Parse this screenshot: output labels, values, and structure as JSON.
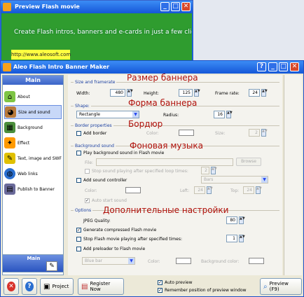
{
  "preview_window": {
    "title": "Preview Flash movie",
    "flash_text": "Create Flash intros, banners and e-cards in just a few clicks",
    "flash_link": "http://www.aleosoft.com",
    "controls": {
      "minimize": "_",
      "maximize": "□",
      "close": "✕"
    }
  },
  "main_window": {
    "title": "Aleo Flash Intro Banner Maker",
    "controls": {
      "help": "?",
      "minimize": "_",
      "maximize": "□",
      "close": "✕"
    }
  },
  "sidebar": {
    "header": "Main",
    "footer": "Main",
    "items": [
      {
        "label": "About",
        "icon": "house-icon",
        "color": "#7ec544"
      },
      {
        "label": "Size and sound",
        "icon": "palette-icon",
        "color": "#b97a3a"
      },
      {
        "label": "Background",
        "icon": "background-icon",
        "color": "#4c8f3c"
      },
      {
        "label": "Effect",
        "icon": "effect-icon",
        "color": "#ff9a00"
      },
      {
        "label": "Text, image and SWF",
        "icon": "pencil-icon",
        "color": "#e0c000"
      },
      {
        "label": "Web links",
        "icon": "globe-icon",
        "color": "#2a6fd0"
      },
      {
        "label": "Publish to Banner",
        "icon": "publish-icon",
        "color": "#6a6a9a"
      }
    ]
  },
  "size": {
    "section": "Size and framerate",
    "width_label": "Width:",
    "width": "480",
    "height_label": "Height:",
    "height": "125",
    "framerate_label": "Frame rate:",
    "framerate": "24"
  },
  "shape": {
    "section": "Shape:",
    "value": "Rectangle",
    "radius_label": "Radius:",
    "radius": "16"
  },
  "border": {
    "section": "Border properties",
    "add_label": "Add border",
    "color_label": "Color:",
    "size_label": "Size:",
    "size": "2"
  },
  "sound": {
    "section": "Background sound",
    "play_label": "Play background sound in Flash movie",
    "file_label": "File:",
    "browse": "Browse",
    "stop_label": "Stop sound playing after specified loop times:",
    "loops": "2",
    "controller_label": "Add sound controller",
    "controller_type": "Bars",
    "color_label": "Color:",
    "left_label": "Left:",
    "left": "24",
    "top_label": "Top:",
    "top": "24",
    "autostart_label": "Auto start sound"
  },
  "options": {
    "section": "Options",
    "jpeg_label": "JPEG Quality:",
    "jpeg": "80",
    "compressed_label": "Generate compressed Flash movie",
    "stop_label": "Stop Flash movie playing after specified times:",
    "stop_times": "1",
    "preloader_label": "Add preloader to Flash movie",
    "preloader_type": "Blue bar",
    "color_label": "Color:",
    "bg_color_label": "Background color:"
  },
  "annotations": {
    "size": "Размер баннера",
    "shape": "Форма баннера",
    "border": "Бордюр",
    "music": "Фоновая музыка",
    "extra": "Дополнительные настройки"
  },
  "bottom": {
    "project": "Project",
    "register": "Register Now",
    "auto_preview": "Auto preview",
    "remember": "Remember position of preview window",
    "preview": "Preview (F9)"
  }
}
